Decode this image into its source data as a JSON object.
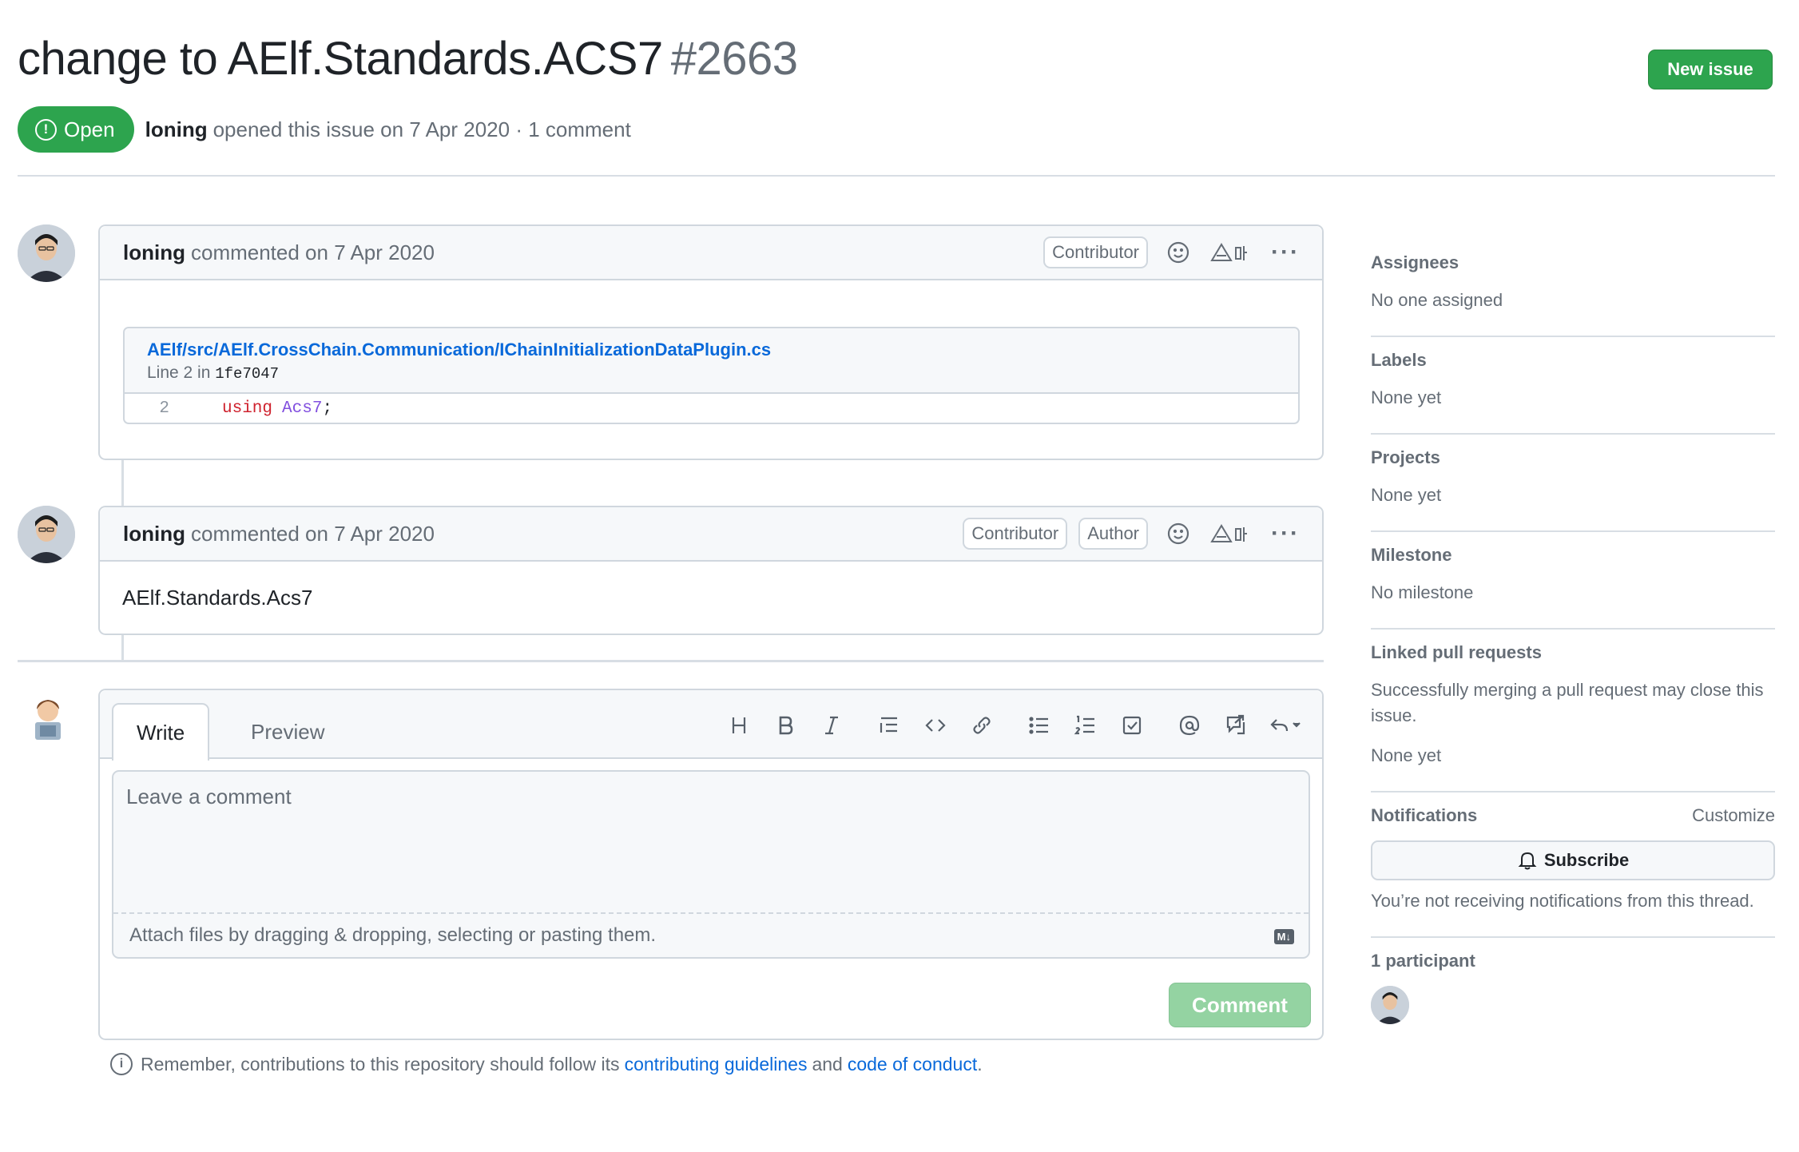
{
  "issue": {
    "title": "change to AElf.Standards.ACS7",
    "number": "#2663",
    "state": "Open",
    "author": "loning",
    "meta": "opened this issue on 7 Apr 2020 · 1 comment",
    "new_issue_label": "New issue"
  },
  "comments": [
    {
      "author": "loning",
      "action": "commented on 7 Apr 2020",
      "badges": [
        "Contributor"
      ],
      "snippet": {
        "path": "AElf/src/AElf.CrossChain.Communication/IChainInitializationDataPlugin.cs",
        "line_text": "Line 2 in",
        "commit": "1fe7047",
        "line_number": "2",
        "code_keyword": "using",
        "code_type": "Acs7",
        "code_end": ";"
      }
    },
    {
      "author": "loning",
      "action": "commented on 7 Apr 2020",
      "badges": [
        "Contributor",
        "Author"
      ],
      "body": "AElf.Standards.Acs7"
    }
  ],
  "composer": {
    "tab_write": "Write",
    "tab_preview": "Preview",
    "placeholder": "Leave a comment",
    "attach_text": "Attach files by dragging & dropping, selecting or pasting them.",
    "markdown_badge": "M↓",
    "submit_label": "Comment"
  },
  "reminder": {
    "prefix": "Remember, contributions to this repository should follow its",
    "link1": "contributing guidelines",
    "and": "and",
    "link2": "code of conduct",
    "suffix": "."
  },
  "sidebar": {
    "assignees_title": "Assignees",
    "assignees_value": "No one assigned",
    "labels_title": "Labels",
    "labels_value": "None yet",
    "projects_title": "Projects",
    "projects_value": "None yet",
    "milestone_title": "Milestone",
    "milestone_value": "No milestone",
    "linked_title": "Linked pull requests",
    "linked_desc": "Successfully merging a pull request may close this issue.",
    "linked_value": "None yet",
    "notifications_title": "Notifications",
    "customize_label": "Customize",
    "subscribe_label": "Subscribe",
    "notifications_desc": "You’re not receiving notifications from this thread.",
    "participants_title": "1 participant"
  },
  "colors": {
    "open_green": "#2da44e",
    "link_blue": "#0969da",
    "muted": "#656d76",
    "border": "#d0d7de"
  }
}
